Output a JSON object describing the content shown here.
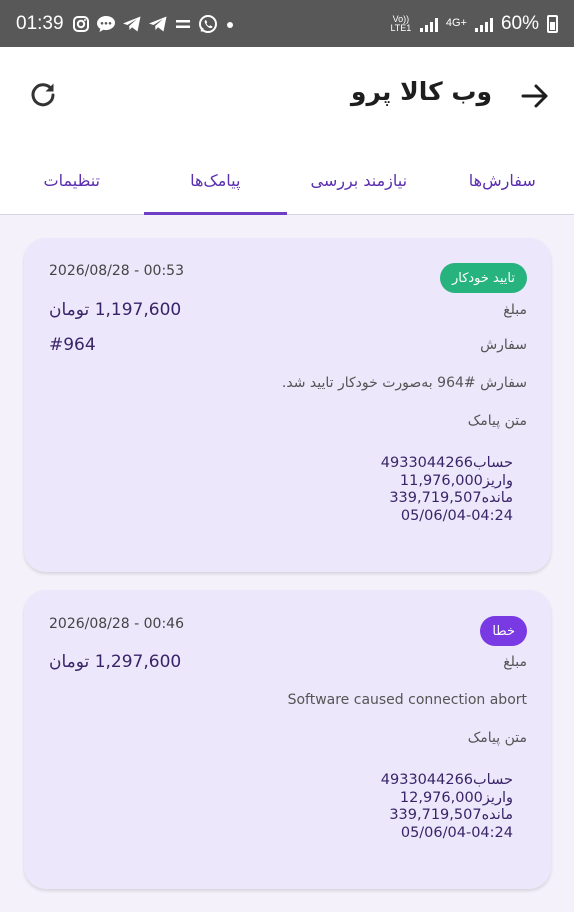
{
  "status_bar": {
    "time": "01:39",
    "battery": "60%",
    "net_label_1": "Vo)) LTE1",
    "net_label_2": "4G+",
    "icons": [
      "instagram-icon",
      "chat-icon",
      "telegram-icon",
      "telegram-icon",
      "equals-icon",
      "whatsapp-icon",
      "dot-icon"
    ]
  },
  "header": {
    "title": "وب کالا پرو",
    "back_icon": "arrow-right-icon",
    "refresh_icon": "refresh-icon"
  },
  "tabs": [
    {
      "label": "سفارش‌ها",
      "active": false
    },
    {
      "label": "نیازمند بررسی",
      "active": false
    },
    {
      "label": "پیامک‌ها",
      "active": true
    },
    {
      "label": "تنظیمات",
      "active": false
    }
  ],
  "messages": [
    {
      "datetime": "2026/08/28 - 00:53",
      "badge": "تایید خودکار",
      "badge_color": "#26b37e",
      "amount_label": "مبلغ",
      "amount": "1,197,600 تومان",
      "order_label": "سفارش",
      "order": "#964",
      "note": "سفارش #964 به‌صورت خودکار تایید شد.",
      "sms_label": "متن پیامک",
      "sms_text": "حساب4933044266\nواریز11,976,000\nمانده339,719,507\n05/06/04-04:24"
    },
    {
      "datetime": "2026/08/28 - 00:46",
      "badge": "خطا",
      "badge_color": "#7a3ae3",
      "amount_label": "مبلغ",
      "amount": "1,297,600 تومان",
      "note": "Software caused connection abort",
      "sms_label": "متن پیامک",
      "sms_text": "حساب4933044266\nواریز12,976,000\nمانده339,719,507\n05/06/04-04:24"
    }
  ],
  "colors": {
    "accent": "#6c3fc4",
    "card_bg": "#ece7fb",
    "page_bg": "#f4f1fa"
  }
}
